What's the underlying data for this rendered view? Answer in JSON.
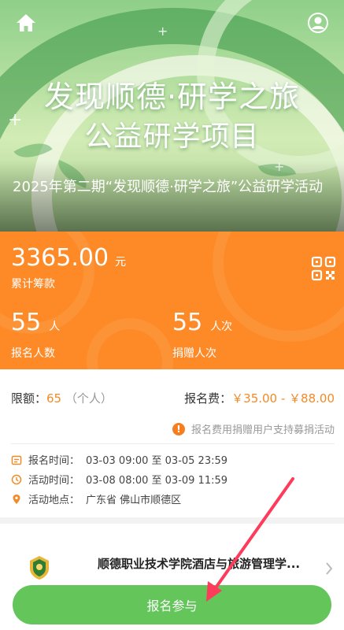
{
  "banner": {
    "headline_line1": "发现顺德·研学之旅",
    "headline_line2": "公益研学项目",
    "title": "2025年第二期“发现顺德·研学之旅”公益研学活动"
  },
  "icons": {
    "home": "home-icon",
    "user": "user-icon",
    "qr": "qr-code-icon"
  },
  "stats": {
    "total_amount": "3365.00",
    "total_amount_unit": "元",
    "total_amount_label": "累计筹款",
    "signup_count": "55",
    "signup_unit": "人",
    "signup_label": "报名人数",
    "donation_count": "55",
    "donation_unit": "人次",
    "donation_label": "捐赠人次"
  },
  "info": {
    "quota_label": "限额：",
    "quota_value": "65",
    "quota_unit": "（个人）",
    "fee_label": "报名费：",
    "fee_value": "￥35.00 - ￥88.00",
    "notice": "报名费用捐赠用户支持募捐活动",
    "signup_time_label": "报名时间：",
    "signup_time": "03-03 09:00 至 03-05 23:59",
    "activity_time_label": "活动时间：",
    "activity_time": "03-08 08:00 至 03-09 11:59",
    "location_label": "活动地点：",
    "location": "广东省 佛山市顺德区"
  },
  "organizer": {
    "name": "顺德职业技术学院酒店与旅游管理学..."
  },
  "actions": {
    "signup_button": "报名参与"
  },
  "colors": {
    "orange": "#fd8a27",
    "green_button": "#63c55a",
    "accent_text": "#f28a26"
  }
}
